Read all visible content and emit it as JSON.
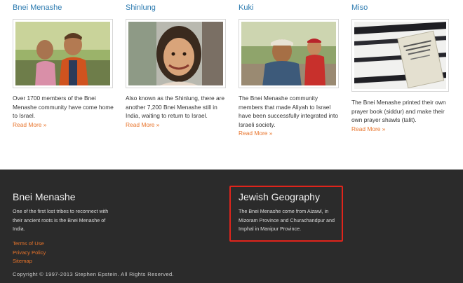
{
  "cards": [
    {
      "title": "Bnei Menashe",
      "text": "Over 1700 members of the Bnei Menashe community have come home to Israel.",
      "link": "Read More »",
      "image": "two-women-photo"
    },
    {
      "title": "Shinlung",
      "text": "Also known as the Shinlung, there are another 7,200 Bnei Menashe still in India, waiting to return to Israel.",
      "link": "Read More »",
      "image": "smiling-girl-photo"
    },
    {
      "title": "Kuki",
      "text": "The Bnei Menashe community members that made Aliyah to Israel have been successfully integrated into Israeli society.",
      "link": "Read More »",
      "image": "man-holding-child-photo"
    },
    {
      "title": "Miso",
      "text": "The Bnei Menashe printed their own prayer book (siddur) and make their own prayer shawls (talit).",
      "link": "Read More »",
      "image": "prayer-book-photo"
    }
  ],
  "footer": {
    "about_title": "Bnei Menashe",
    "about_text": "One of the first lost tribes to reconnect with their ancient roots is the Bnei Menashe of India.",
    "geo_title": "Jewish Geography",
    "geo_text": "The Bnei Menashe come from Aizawl, in Mizoram Province and Churachandpur and Imphal in Manipur Province.",
    "links": [
      "Terms of Use",
      "Privacy Policy",
      "Sitemap"
    ],
    "copyright": "Copyright © 1997-2013 Stephen Epstein. All Rights Reserved."
  },
  "colors": {
    "link": "#2d7bb0",
    "accent": "#e8742b",
    "footer_bg": "#2b2b2b",
    "highlight": "#e0241b"
  }
}
